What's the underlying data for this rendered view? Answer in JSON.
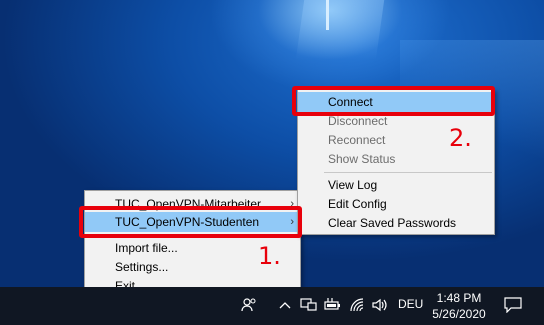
{
  "tray_menu": {
    "items": [
      {
        "label": "TUC_OpenVPN-Mitarbeiter",
        "submenu": true
      },
      {
        "label": "TUC_OpenVPN-Studenten",
        "submenu": true
      },
      {
        "label": "Import file..."
      },
      {
        "label": "Settings..."
      },
      {
        "label": "Exit"
      }
    ]
  },
  "connection_submenu": {
    "items": [
      {
        "label": "Connect",
        "enabled": true
      },
      {
        "label": "Disconnect",
        "enabled": false
      },
      {
        "label": "Reconnect",
        "enabled": false
      },
      {
        "label": "Show Status",
        "enabled": false
      },
      {
        "label": "View Log",
        "enabled": true
      },
      {
        "label": "Edit Config",
        "enabled": true
      },
      {
        "label": "Clear Saved Passwords",
        "enabled": true
      }
    ]
  },
  "annotations": {
    "step1": "1.",
    "step2": "2."
  },
  "taskbar": {
    "language": "DEU",
    "time": "1:48 PM",
    "date": "5/26/2020",
    "icons": [
      "people-icon",
      "chevron-up-icon",
      "network-icon",
      "battery-icon",
      "wifi-icon",
      "volume-icon",
      "notification-icon"
    ]
  },
  "colors": {
    "highlight": "#91c9f7",
    "annotation_red": "#e8000b",
    "taskbar": "#101723"
  }
}
